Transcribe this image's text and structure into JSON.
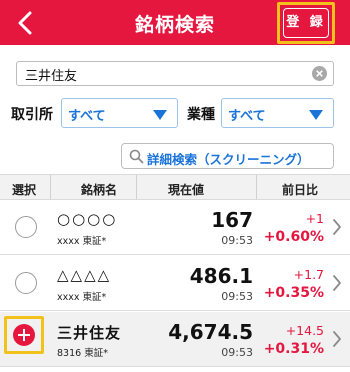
{
  "header": {
    "title": "銘柄検索",
    "register_label": "登 録",
    "color": "#e5173f",
    "highlight_color": "#f3c21a"
  },
  "search": {
    "value": "三井住友"
  },
  "filters": {
    "exchange_label": "取引所",
    "exchange_value": "すべて",
    "industry_label": "業種",
    "industry_value": "すべて"
  },
  "detail_search_label": "詳細検索（スクリーニング）",
  "table": {
    "columns": [
      "選択",
      "銘柄名",
      "現在値",
      "前日比"
    ],
    "rows": [
      {
        "name": "○○○○",
        "code": "xxxx",
        "market": "東証*",
        "price": "167",
        "time": "09:53",
        "change": "+1",
        "change_pct": "+0.60%"
      },
      {
        "name": "△△△△",
        "code": "xxxx",
        "market": "東証*",
        "price": "486.1",
        "time": "09:53",
        "change": "+1.7",
        "change_pct": "+0.35%"
      },
      {
        "name": "三井住友",
        "code": "8316",
        "market": "東証*",
        "price": "4,674.5",
        "time": "09:53",
        "change": "+14.5",
        "change_pct": "+0.31%"
      }
    ]
  }
}
